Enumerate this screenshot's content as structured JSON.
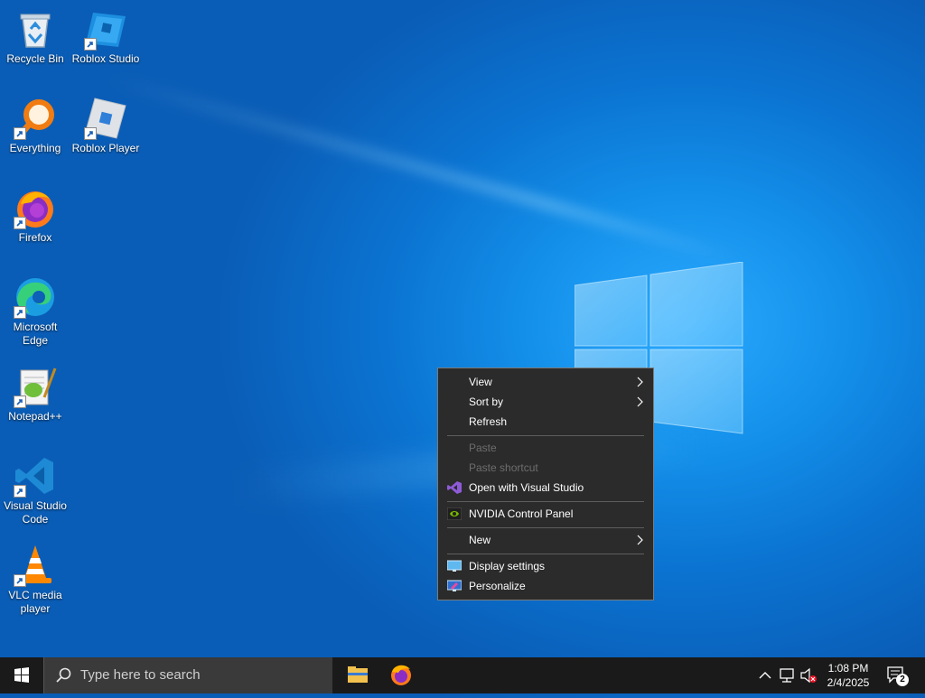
{
  "desktop_icons": [
    {
      "label": "Recycle Bin",
      "icon": "recycle-bin-icon"
    },
    {
      "label": "Roblox Studio",
      "icon": "roblox-studio-icon"
    },
    {
      "label": "Everything",
      "icon": "everything-search-icon"
    },
    {
      "label": "Roblox Player",
      "icon": "roblox-player-icon"
    },
    {
      "label": "Firefox",
      "icon": "firefox-icon"
    },
    {
      "label": "Microsoft Edge",
      "icon": "edge-icon"
    },
    {
      "label": "Notepad++",
      "icon": "notepadpp-icon"
    },
    {
      "label": "Visual Studio Code",
      "icon": "vscode-icon"
    },
    {
      "label": "VLC media player",
      "icon": "vlc-icon"
    }
  ],
  "context_menu": {
    "items": [
      {
        "label": "View",
        "submenu": true,
        "enabled": true
      },
      {
        "label": "Sort by",
        "submenu": true,
        "enabled": true
      },
      {
        "label": "Refresh",
        "enabled": true
      },
      {
        "label": "Paste",
        "enabled": false
      },
      {
        "label": "Paste shortcut",
        "enabled": false
      },
      {
        "label": "Open with Visual Studio",
        "enabled": true,
        "icon": "visual-studio-icon"
      },
      {
        "label": "NVIDIA Control Panel",
        "enabled": true,
        "icon": "nvidia-icon"
      },
      {
        "label": "New",
        "submenu": true,
        "enabled": true
      },
      {
        "label": "Display settings",
        "enabled": true,
        "icon": "display-icon"
      },
      {
        "label": "Personalize",
        "enabled": true,
        "icon": "personalize-icon"
      }
    ]
  },
  "taskbar": {
    "search_placeholder": "Type here to search",
    "pinned_apps": [
      "file-explorer-icon",
      "firefox-icon"
    ],
    "time": "1:08 PM",
    "date": "2/4/2025",
    "notification_count": "2"
  },
  "colors": {
    "taskbar_bg": "#1a1a1a",
    "menu_bg": "#2b2b2b",
    "wallpaper_blue": "#0b73d1"
  }
}
